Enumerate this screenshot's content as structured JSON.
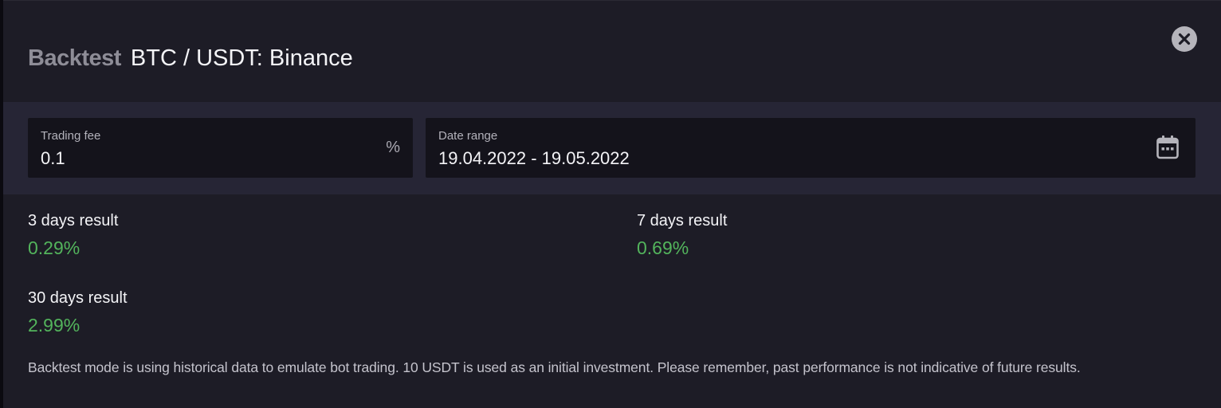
{
  "header": {
    "title_muted": "Backtest",
    "title_pair": "BTC / USDT: Binance"
  },
  "settings": {
    "trading_fee": {
      "label": "Trading fee",
      "value": "0.1",
      "suffix": "%"
    },
    "date_range": {
      "label": "Date range",
      "value": "19.04.2022 - 19.05.2022",
      "icon": "calendar-icon"
    }
  },
  "results": [
    {
      "label": "3 days result",
      "value": "0.29%"
    },
    {
      "label": "7 days result",
      "value": "0.69%"
    },
    {
      "label": "30 days result",
      "value": "2.99%"
    }
  ],
  "note": "Backtest mode is using historical data to emulate bot trading. 10 USDT is used as an initial investment. Please remember, past performance is not indicative of future results.",
  "colors": {
    "background": "#1d1c26",
    "settings_band": "#262535",
    "field_background": "#14131b",
    "positive": "#53b45c",
    "muted_title": "#8e8d97"
  }
}
